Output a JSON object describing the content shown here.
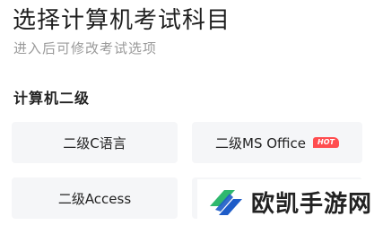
{
  "header": {
    "title": "选择计算机考试科目",
    "subtitle": "进入后可修改考试选项"
  },
  "section": {
    "title": "计算机二级"
  },
  "options": [
    {
      "label": "二级C语言"
    },
    {
      "label": "二级MS Office",
      "badge": "HOT"
    },
    {
      "label": "二级Access"
    },
    {
      "label": ""
    }
  ],
  "watermark": {
    "text": "欧凯手游网"
  },
  "colors": {
    "background": "#ffffff",
    "card": "#f5f6f8",
    "hot": "#ff4d4f",
    "logo_green": "#2fb86e",
    "logo_blue": "#1e5cc8"
  }
}
